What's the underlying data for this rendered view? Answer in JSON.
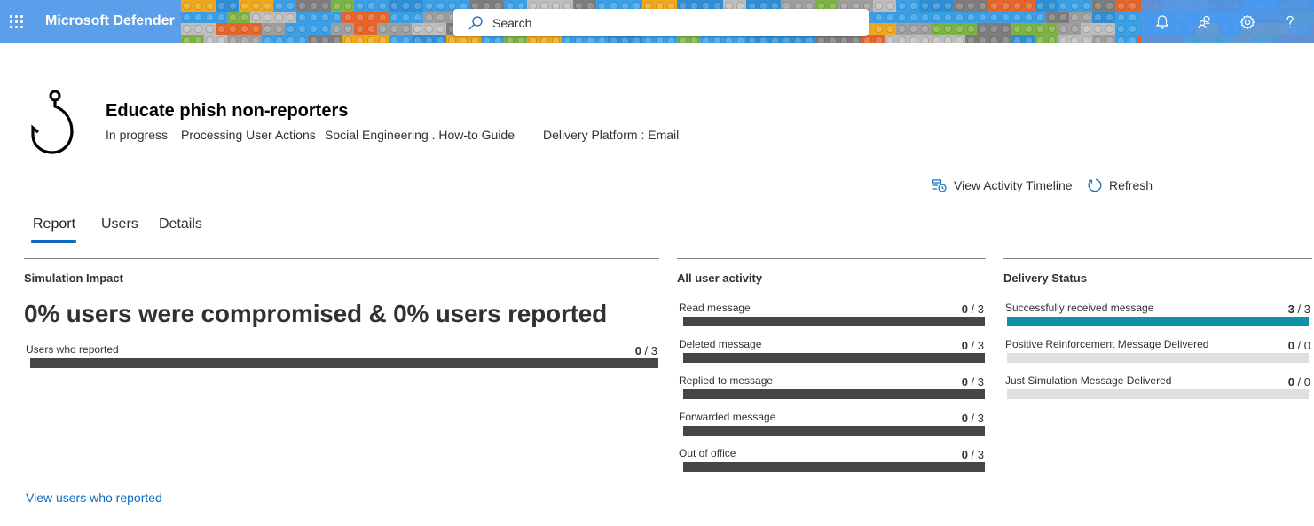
{
  "app": {
    "name": "Microsoft Defender"
  },
  "search": {
    "placeholder": "Search"
  },
  "header_tools": [
    {
      "icon": "bell-icon",
      "label": "Notifications"
    },
    {
      "icon": "people-icon",
      "label": "Community"
    },
    {
      "icon": "gear-icon",
      "label": "Settings"
    },
    {
      "icon": "help-icon",
      "label": "Help"
    }
  ],
  "simulation": {
    "title": "Educate phish non-reporters",
    "status": "In progress",
    "processing": "Processing User Actions",
    "technique": "Social Engineering . How-to Guide",
    "platform": "Delivery Platform : Email"
  },
  "actions": {
    "timeline": "View Activity Timeline",
    "refresh": "Refresh"
  },
  "tabs": [
    {
      "label": "Report",
      "active": true
    },
    {
      "label": "Users",
      "active": false
    },
    {
      "label": "Details",
      "active": false
    }
  ],
  "impact": {
    "title": "Simulation Impact",
    "headline": "0% users were compromised & 0% users reported",
    "metric": {
      "label": "Users who reported",
      "value": "0",
      "total": " / 3",
      "fraction": 0
    },
    "link": "View users who reported"
  },
  "activity": {
    "title": "All user activity",
    "metrics": [
      {
        "label": "Read message",
        "value": "0",
        "total": " / 3",
        "fraction": 0
      },
      {
        "label": "Deleted message",
        "value": "0",
        "total": " / 3",
        "fraction": 0
      },
      {
        "label": "Replied to message",
        "value": "0",
        "total": " / 3",
        "fraction": 0
      },
      {
        "label": "Forwarded message",
        "value": "0",
        "total": " / 3",
        "fraction": 0
      },
      {
        "label": "Out of office",
        "value": "0",
        "total": " / 3",
        "fraction": 0
      }
    ]
  },
  "delivery": {
    "title": "Delivery Status",
    "metrics": [
      {
        "label": "Successfully received message",
        "value": "3",
        "total": " / 3",
        "fraction": 1
      },
      {
        "label": "Positive Reinforcement Message Delivered",
        "value": "0",
        "total": " / 0",
        "fraction": 0
      },
      {
        "label": "Just Simulation Message Delivered",
        "value": "0",
        "total": " / 0",
        "fraction": 0
      }
    ]
  },
  "colors": {
    "accent": "#0f6cbd",
    "bar_fill": "#0f91a8",
    "bar_dark": "#484644",
    "bar_light": "#e1dfdd",
    "header": "#4a90e2"
  }
}
